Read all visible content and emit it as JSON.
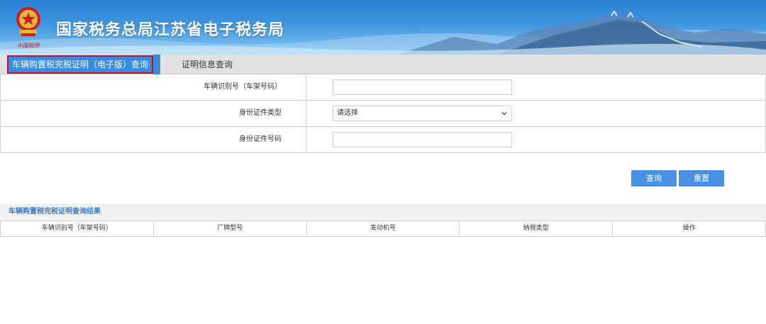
{
  "header": {
    "title": "国家税务总局江苏省电子税务局",
    "emblem_icon": "tax-emblem-icon",
    "seal_text": "中国税务"
  },
  "tabs": [
    {
      "label": "车辆购置税完税证明（电子版）查询",
      "active": true
    },
    {
      "label": "证明信息查询",
      "active": false
    }
  ],
  "form": {
    "vin_label": "车辆识别号（车架号码）",
    "vin_value": "",
    "id_type_label": "身份证件类型",
    "id_type_selected": "请选择",
    "id_number_label": "身份证件号码",
    "id_number_value": ""
  },
  "buttons": {
    "query": "查询",
    "reset": "重置"
  },
  "results": {
    "title": "车辆购置税完税证明查询结果",
    "columns": [
      "车辆识别号（车架号码）",
      "厂牌型号",
      "发动机号",
      "纳税类型",
      "操作"
    ]
  },
  "colors": {
    "accent": "#4a90e2",
    "active_tab": "#3a8bdd",
    "active_tab_border": "#c0102a",
    "banner_top": "#2b7fd2"
  }
}
